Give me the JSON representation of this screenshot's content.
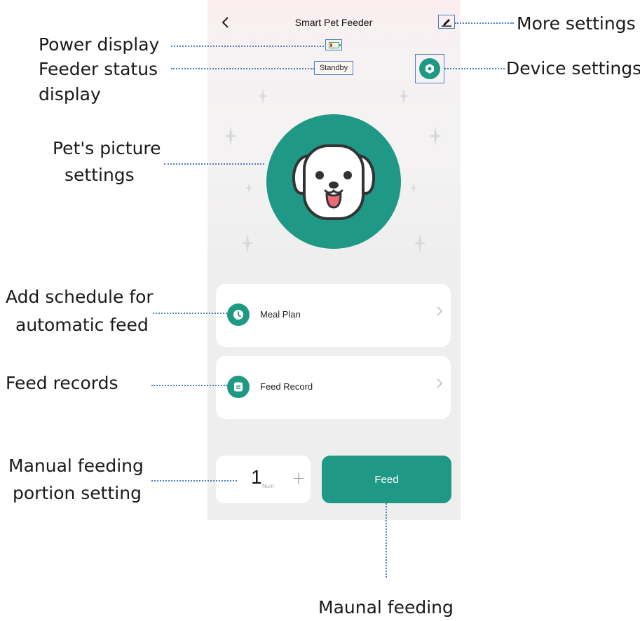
{
  "app": {
    "title": "Smart Pet Feeder",
    "back_icon": "chevron-left-icon",
    "edit_icon": "pencil-icon",
    "settings_icon": "gear-icon"
  },
  "device": {
    "battery_level": 0.25,
    "status": "Standby"
  },
  "menu": [
    {
      "label": "Meal Plan",
      "icon": "clock-icon"
    },
    {
      "label": "Feed Record",
      "icon": "list-icon"
    }
  ],
  "portion": {
    "value": "1",
    "unit": "Num",
    "plus": "+"
  },
  "feed_button": {
    "label": "Feed"
  },
  "callouts": {
    "more_settings": "More settings",
    "power_display": "Power display",
    "feeder_status_1": "Feeder status",
    "feeder_status_2": "display",
    "device_settings": "Device settings",
    "pet_picture_1": "Pet's picture",
    "pet_picture_2": "settings",
    "schedule_1": "Add schedule for",
    "schedule_2": "automatic feed",
    "feed_records": "Feed records",
    "manual_portion_1": "Manual feeding",
    "manual_portion_2": "portion setting",
    "manual_feeding": "Maunal feeding"
  },
  "colors": {
    "accent": "#1f9985",
    "callout_line": "#4a7fc1",
    "card_bg": "#ffffff",
    "screen_bg": "#eeeeee"
  }
}
